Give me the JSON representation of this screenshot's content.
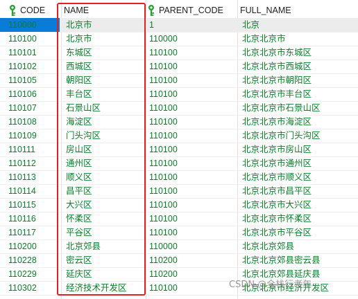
{
  "table": {
    "columns": [
      {
        "label": "CODE",
        "key_icon": true
      },
      {
        "label": "NAME",
        "key_icon": false
      },
      {
        "label": "PARENT_CODE",
        "key_icon": true
      },
      {
        "label": "FULL_NAME",
        "key_icon": false
      }
    ],
    "rows": [
      {
        "code": "110000",
        "name": "北京市",
        "parent": "1",
        "full": "北京"
      },
      {
        "code": "110100",
        "name": "北京市",
        "parent": "110000",
        "full": "北京北京市"
      },
      {
        "code": "110101",
        "name": "东城区",
        "parent": "110100",
        "full": "北京北京市东城区"
      },
      {
        "code": "110102",
        "name": "西城区",
        "parent": "110100",
        "full": "北京北京市西城区"
      },
      {
        "code": "110105",
        "name": "朝阳区",
        "parent": "110100",
        "full": "北京北京市朝阳区"
      },
      {
        "code": "110106",
        "name": "丰台区",
        "parent": "110100",
        "full": "北京北京市丰台区"
      },
      {
        "code": "110107",
        "name": "石景山区",
        "parent": "110100",
        "full": "北京北京市石景山区"
      },
      {
        "code": "110108",
        "name": "海淀区",
        "parent": "110100",
        "full": "北京北京市海淀区"
      },
      {
        "code": "110109",
        "name": "门头沟区",
        "parent": "110100",
        "full": "北京北京市门头沟区"
      },
      {
        "code": "110111",
        "name": "房山区",
        "parent": "110100",
        "full": "北京北京市房山区"
      },
      {
        "code": "110112",
        "name": "通州区",
        "parent": "110100",
        "full": "北京北京市通州区"
      },
      {
        "code": "110113",
        "name": "顺义区",
        "parent": "110100",
        "full": "北京北京市顺义区"
      },
      {
        "code": "110114",
        "name": "昌平区",
        "parent": "110100",
        "full": "北京北京市昌平区"
      },
      {
        "code": "110115",
        "name": "大兴区",
        "parent": "110100",
        "full": "北京北京市大兴区"
      },
      {
        "code": "110116",
        "name": "怀柔区",
        "parent": "110100",
        "full": "北京北京市怀柔区"
      },
      {
        "code": "110117",
        "name": "平谷区",
        "parent": "110100",
        "full": "北京北京市平谷区"
      },
      {
        "code": "110200",
        "name": "北京郊县",
        "parent": "110000",
        "full": "北京北京郊县"
      },
      {
        "code": "110228",
        "name": "密云区",
        "parent": "110200",
        "full": "北京北京郊县密云县"
      },
      {
        "code": "110229",
        "name": "延庆区",
        "parent": "110200",
        "full": "北京北京郊县延庆县"
      },
      {
        "code": "110302",
        "name": "经济技术开发区",
        "parent": "110100",
        "full": "北京北京市经济开发区"
      }
    ],
    "selected_row": 0
  },
  "watermark": "CSDN @全栈行者年",
  "colors": {
    "cell_text": "#0b7d2a",
    "selected_code_bg": "#0a7bd6",
    "highlight_box": "#e0211f",
    "key_icon": "#2e9e3a"
  }
}
